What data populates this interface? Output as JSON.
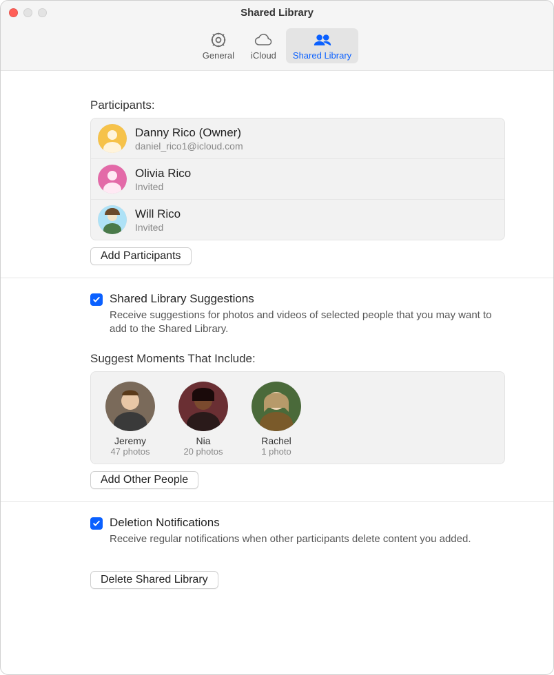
{
  "window": {
    "title": "Shared Library"
  },
  "tabs": {
    "items": [
      {
        "label": "General"
      },
      {
        "label": "iCloud"
      },
      {
        "label": "Shared Library"
      }
    ],
    "selected_index": 2
  },
  "participants": {
    "heading": "Participants:",
    "rows": [
      {
        "name": "Danny Rico (Owner)",
        "sub": "daniel_rico1@icloud.com",
        "avatar_bg": "#f6c24a"
      },
      {
        "name": "Olivia Rico",
        "sub": "Invited",
        "avatar_bg": "#e36aa8"
      },
      {
        "name": "Will Rico",
        "sub": "Invited",
        "avatar_bg": "#7ec5e8"
      }
    ],
    "add_button": "Add Participants"
  },
  "suggestions": {
    "checkbox_label": "Shared Library Suggestions",
    "checkbox_checked": true,
    "desc": "Receive suggestions for photos and videos of selected people that you may want to add to the Shared Library.",
    "moments_heading": "Suggest Moments That Include:",
    "people": [
      {
        "name": "Jeremy",
        "count": "47 photos",
        "face_bg": "#7a6a5a"
      },
      {
        "name": "Nia",
        "count": "20 photos",
        "face_bg": "#6a2f33"
      },
      {
        "name": "Rachel",
        "count": "1 photo",
        "face_bg": "#b79a6a"
      }
    ],
    "add_people_button": "Add Other People"
  },
  "deletion": {
    "checkbox_label": "Deletion Notifications",
    "checkbox_checked": true,
    "desc": "Receive regular notifications when other participants delete content you added."
  },
  "delete_button": "Delete Shared Library"
}
